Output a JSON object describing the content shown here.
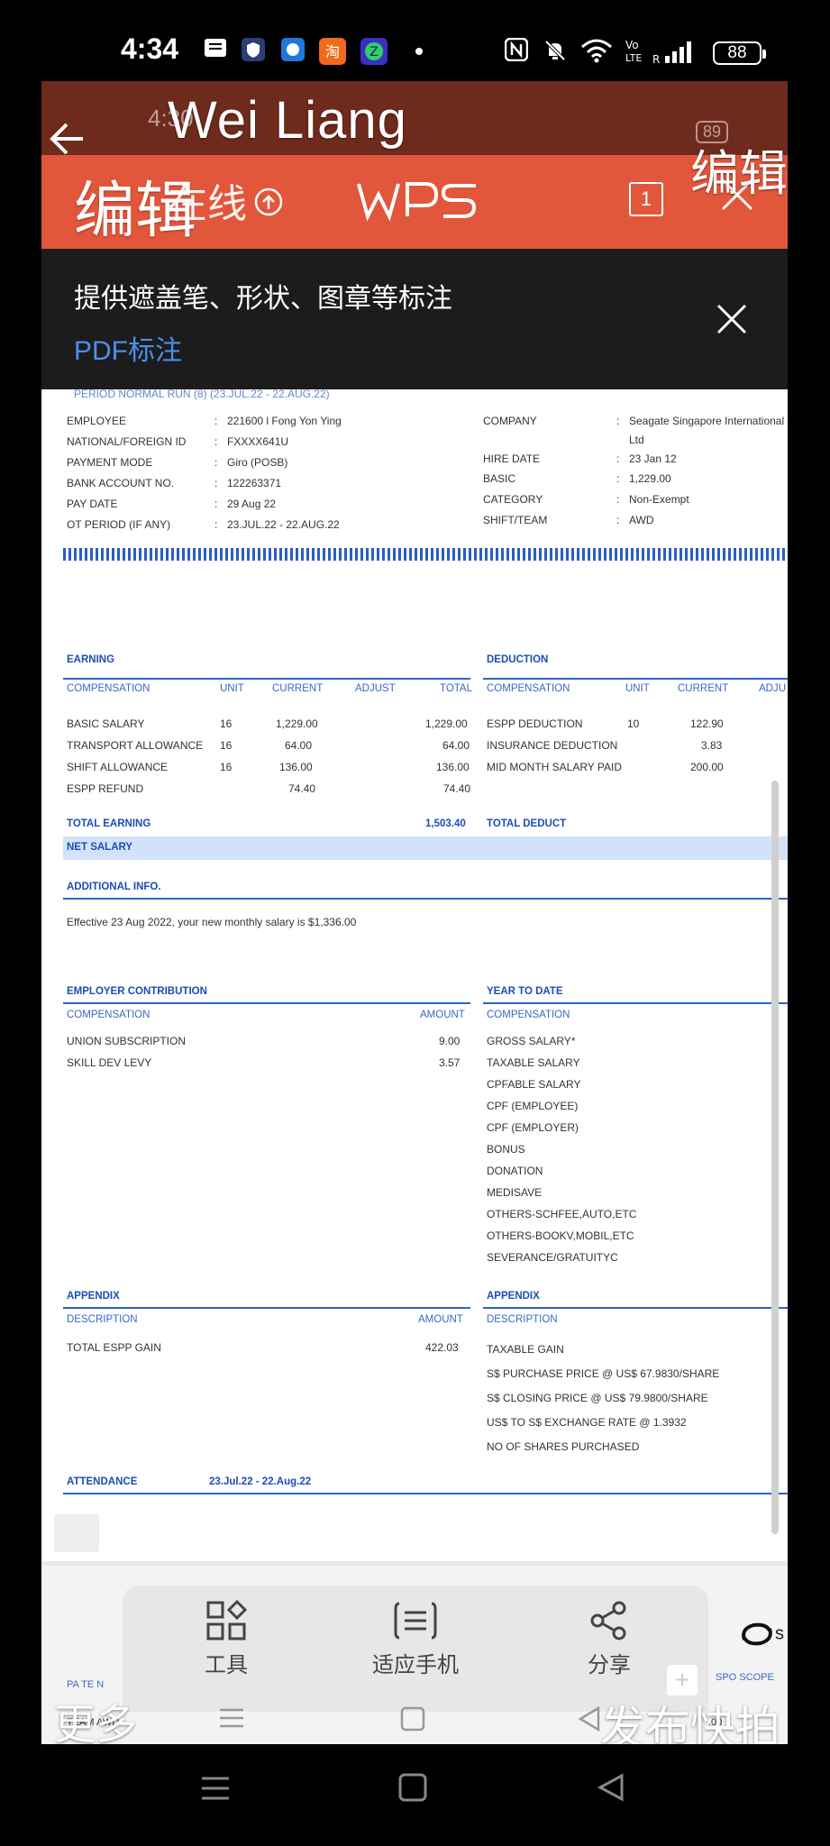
{
  "status_bar": {
    "time": "4:34",
    "battery": "88"
  },
  "inner_status": {
    "time": "4:30",
    "battery": "89"
  },
  "overlay": {
    "title": "Wei Liang",
    "edit_left": "编辑",
    "edit_right": "编辑",
    "more": "更多",
    "publish": "发布快拍"
  },
  "wps": {
    "online_label": "在线",
    "logo_text": "WPS",
    "page_count": "1"
  },
  "tip": {
    "text": "提供遮盖笔、形状、图章等标注",
    "link": "PDF标注"
  },
  "payslip": {
    "header_faint": "PAY SLIP",
    "period": "PERIOD NORMAL RUN (8) (23.JUL.22 - 22.AUG.22)",
    "left_fields": [
      {
        "key": "EMPLOYEE",
        "value": "221600 l Fong Yon Ying"
      },
      {
        "key": "NATIONAL/FOREIGN ID",
        "value": "FXXXX641U"
      },
      {
        "key": "PAYMENT MODE",
        "value": "Giro (POSB)"
      },
      {
        "key": "BANK ACCOUNT NO.",
        "value": "122263371"
      },
      {
        "key": "PAY DATE",
        "value": "29 Aug 22"
      },
      {
        "key": "OT PERIOD (IF ANY)",
        "value": "23.JUL.22 - 22.AUG.22"
      }
    ],
    "right_fields": [
      {
        "key": "COMPANY",
        "value": "Seagate Singapore International"
      },
      {
        "key": "",
        "value": "Ltd"
      },
      {
        "key": "HIRE DATE",
        "value": "23 Jan 12"
      },
      {
        "key": "BASIC",
        "value": "1,229.00"
      },
      {
        "key": "CATEGORY",
        "value": "Non-Exempt"
      },
      {
        "key": "SHIFT/TEAM",
        "value": "AWD"
      }
    ],
    "earning": {
      "title": "EARNING",
      "headers": [
        "COMPENSATION",
        "UNIT",
        "CURRENT",
        "ADJUST",
        "TOTAL"
      ],
      "rows": [
        [
          "BASIC SALARY",
          "16",
          "1,229.00",
          "",
          "1,229.00"
        ],
        [
          "TRANSPORT ALLOWANCE",
          "16",
          "64.00",
          "",
          "64.00"
        ],
        [
          "SHIFT ALLOWANCE",
          "16",
          "136.00",
          "",
          "136.00"
        ],
        [
          "ESPP REFUND",
          "",
          "74.40",
          "",
          "74.40"
        ]
      ],
      "total_label": "TOTAL EARNING",
      "total_value": "1,503.40"
    },
    "deduction": {
      "title": "DEDUCTION",
      "headers": [
        "COMPENSATION",
        "UNIT",
        "CURRENT",
        "ADJU"
      ],
      "rows": [
        [
          "ESPP DEDUCTION",
          "10",
          "122.90"
        ],
        [
          "INSURANCE DEDUCTION",
          "",
          "3.83"
        ],
        [
          "MID MONTH SALARY PAID",
          "",
          "200.00"
        ]
      ],
      "total_label": "TOTAL DEDUCT"
    },
    "net_salary_label": "NET SALARY",
    "additional_title": "ADDITIONAL INFO.",
    "additional_text": "Effective 23 Aug 2022, your new monthly salary is $1,336.00",
    "employer": {
      "title": "EMPLOYER CONTRIBUTION",
      "headers": [
        "COMPENSATION",
        "AMOUNT"
      ],
      "rows": [
        [
          "UNION SUBSCRIPTION",
          "9.00"
        ],
        [
          "SKILL DEV LEVY",
          "3.57"
        ]
      ]
    },
    "ytd": {
      "title": "YEAR TO DATE",
      "header": "COMPENSATION",
      "items": [
        "GROSS SALARY*",
        "TAXABLE SALARY",
        "CPFABLE SALARY",
        "CPF (EMPLOYEE)",
        "CPF (EMPLOYER)",
        "BONUS",
        "DONATION",
        "MEDISAVE",
        "OTHERS-SCHFEE,AUTO,ETC",
        "OTHERS-BOOKV,MOBIL,ETC",
        "SEVERANCE/GRATUITYC"
      ]
    },
    "appendix_left": {
      "title": "APPENDIX",
      "headers": [
        "DESCRIPTION",
        "AMOUNT"
      ],
      "rows": [
        [
          "TOTAL ESPP GAIN",
          "422.03"
        ]
      ]
    },
    "appendix_right": {
      "title": "APPENDIX",
      "header": "DESCRIPTION",
      "items": [
        "TAXABLE GAIN",
        "S$ PURCHASE PRICE @ US$ 67.9830/SHARE",
        "S$ CLOSING PRICE @ US$ 79.9800/SHARE",
        "US$ TO S$ EXCHANGE RATE @ 1.3932",
        "NO OF SHARES PURCHASED"
      ]
    },
    "attendance_label": "ATTENDANCE",
    "attendance_period": "23.Jul.22 - 22.Aug.22"
  },
  "bottom": {
    "toolbar": [
      {
        "label": "工具",
        "icon": "tools-icon"
      },
      {
        "label": "适应手机",
        "icon": "fit-phone-icon"
      },
      {
        "label": "分享",
        "icon": "share-icon"
      }
    ],
    "preview_left": "PA TE N",
    "preview_right": "SPO SCOPE",
    "team_left": "TEAM AWD",
    "team_right": ".00",
    "seagate_logo": "s"
  },
  "colors": {
    "wps_red": "#e2563b",
    "accent_blue": "#2f62c4",
    "net_band": "#d3e2f8"
  }
}
